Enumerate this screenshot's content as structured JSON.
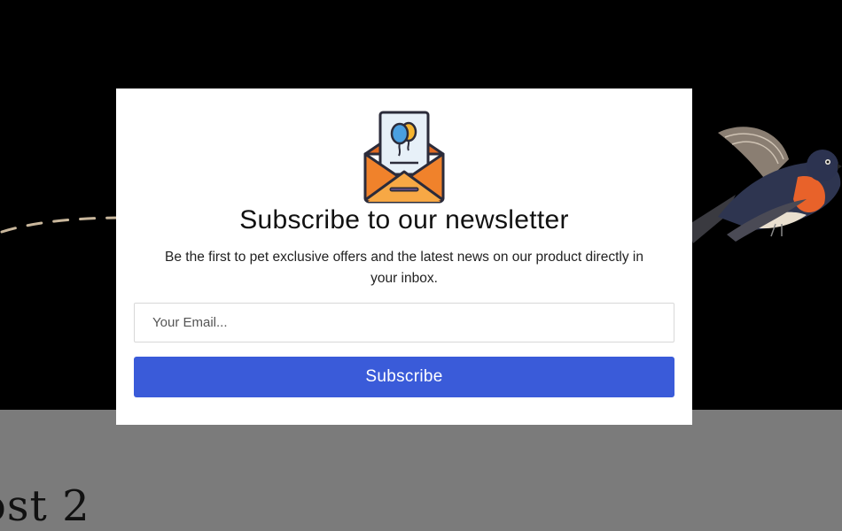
{
  "background_post": {
    "title": "ost 2"
  },
  "modal": {
    "icon": "envelope-with-balloon-card-icon",
    "title": "Subscribe to our newsletter",
    "subtitle": "Be the first to pet exclusive offers and the latest news on our product directly in your inbox.",
    "email_placeholder": "Your Email...",
    "email_value": "",
    "subscribe_label": "Subscribe"
  },
  "colors": {
    "hero_background": "#000000",
    "page_background": "#7b7b7b",
    "modal_background": "#ffffff",
    "button_accent": "#3a5bd9",
    "envelope_orange": "#f0822b",
    "envelope_yellow": "#f7a845",
    "balloon_blue": "#4a9fe0",
    "balloon_yellow": "#f6b530"
  }
}
